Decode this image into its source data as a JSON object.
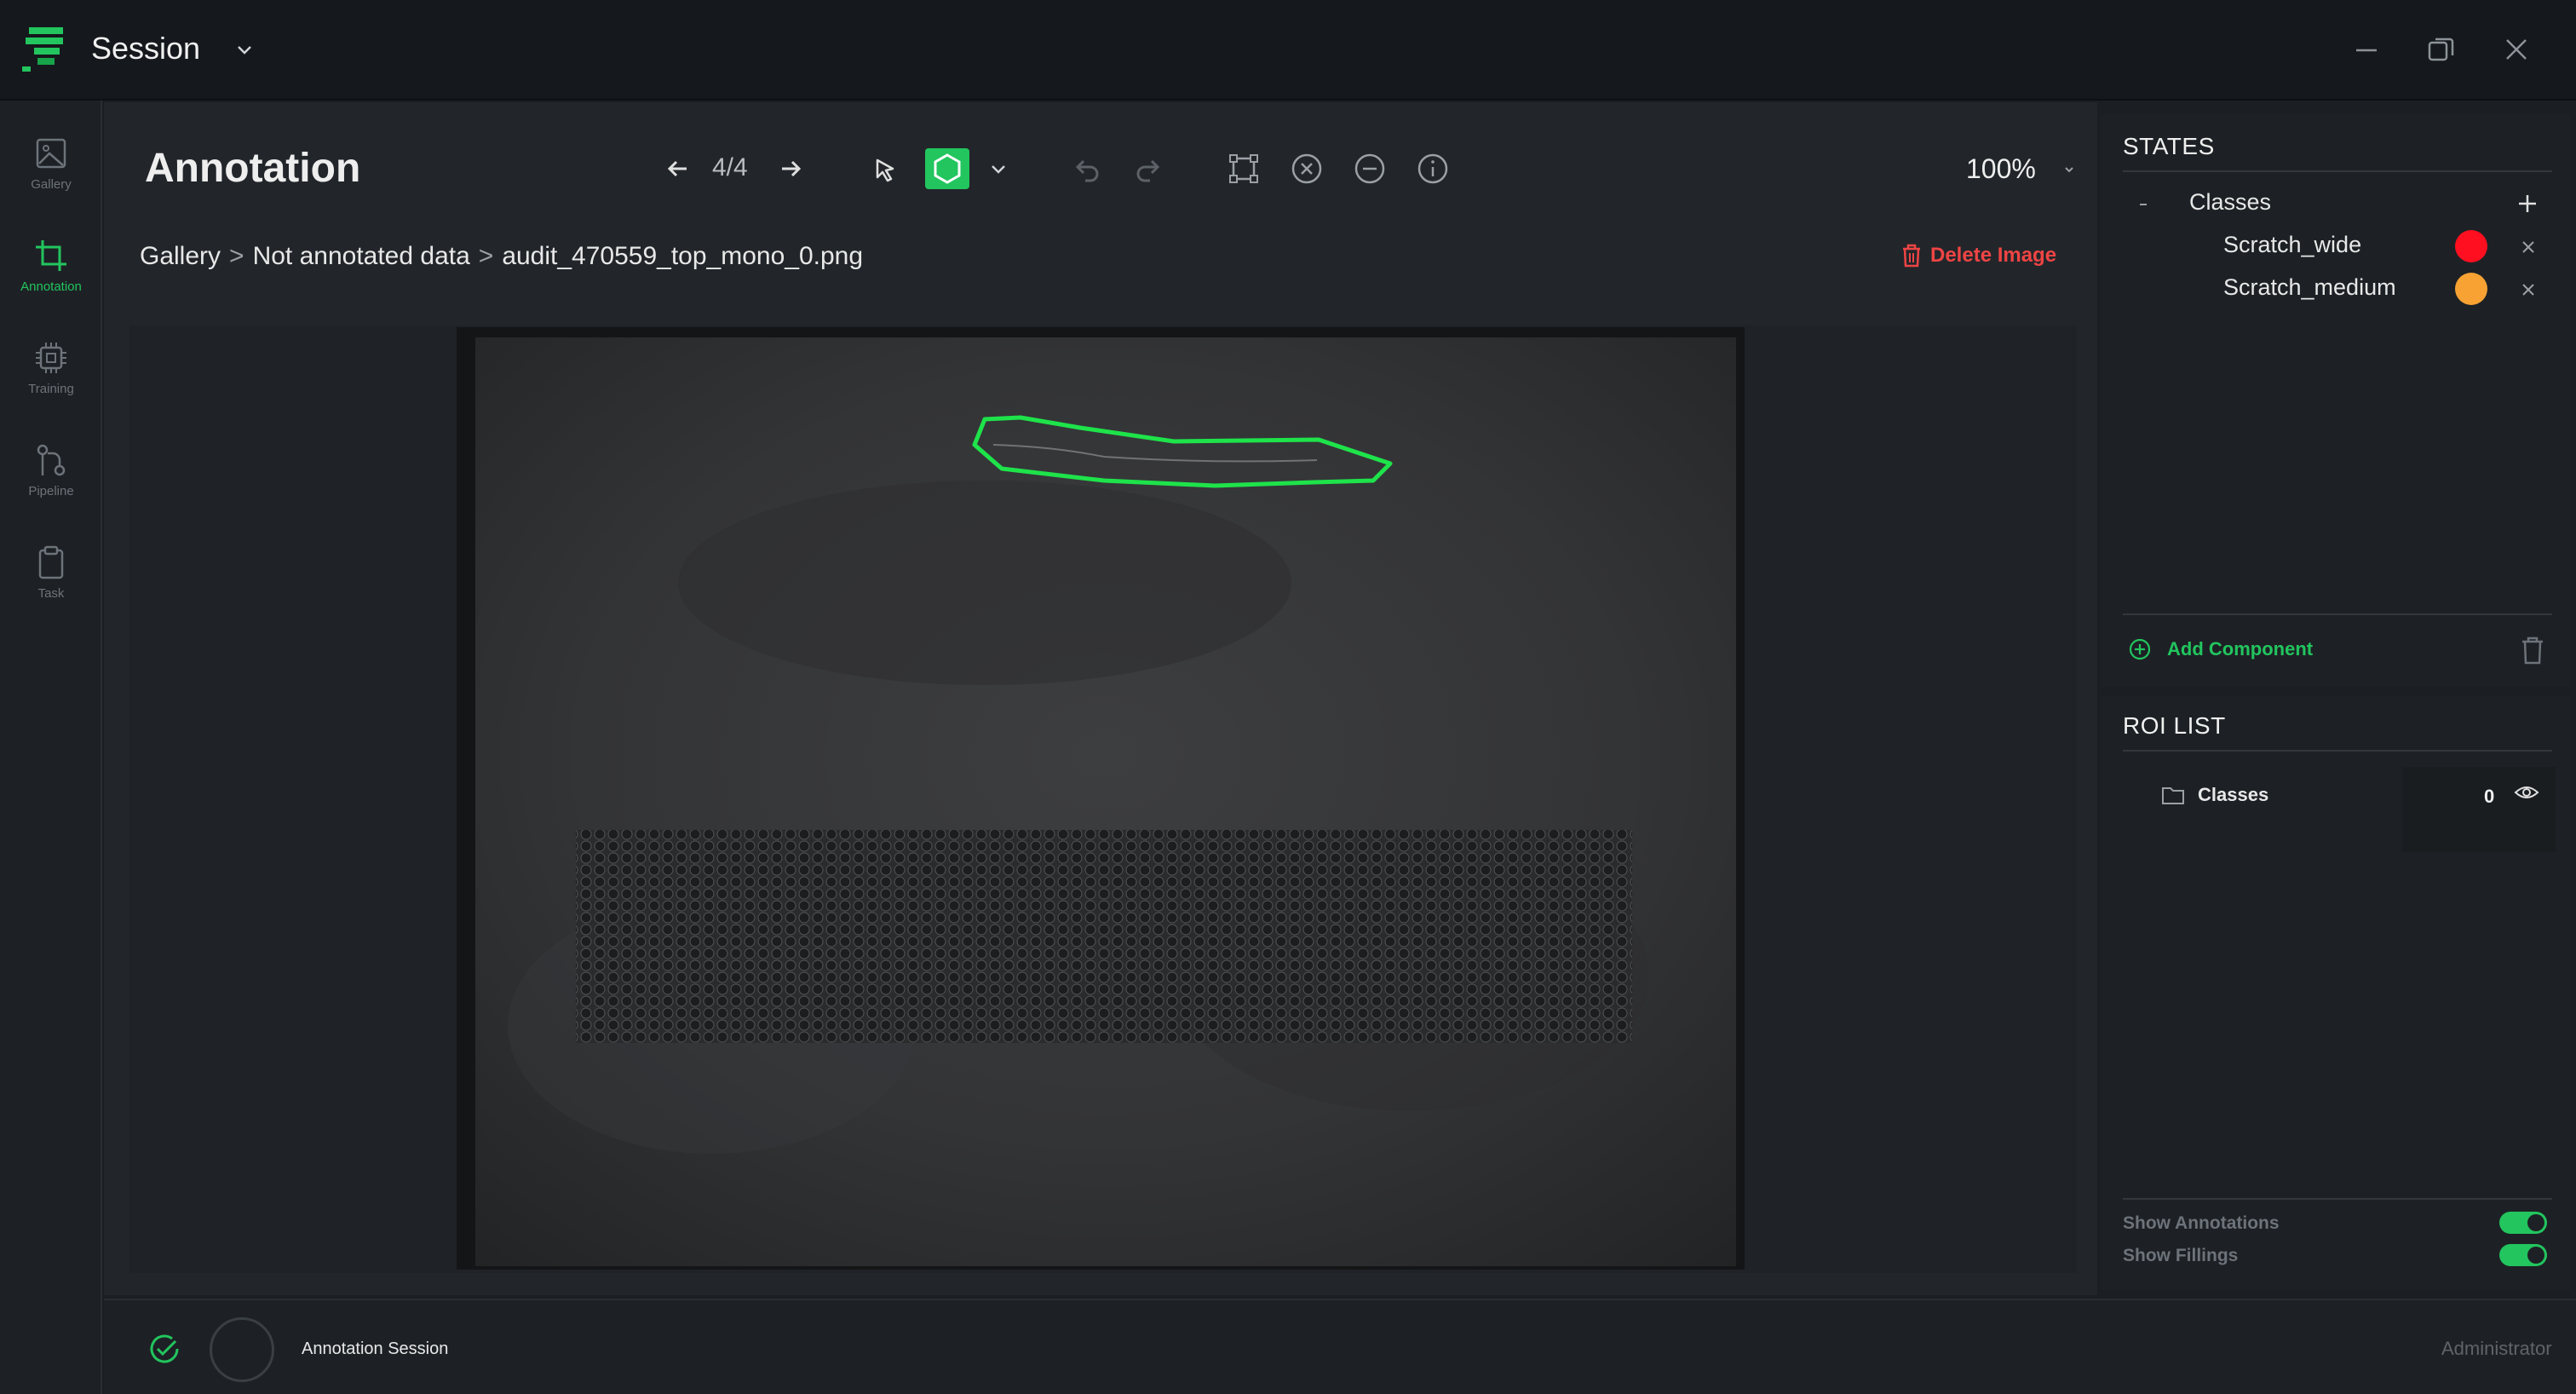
{
  "titlebar": {
    "app_title": "Session",
    "icons": [
      "app-logo",
      "chevron-down-icon",
      "minimize-icon",
      "restore-icon",
      "close-icon"
    ]
  },
  "nav": {
    "items": [
      {
        "label": "Gallery",
        "icon": "image-icon",
        "active": false
      },
      {
        "label": "Annotation",
        "icon": "crop-icon",
        "active": true
      },
      {
        "label": "Training",
        "icon": "chip-icon",
        "active": false
      },
      {
        "label": "Pipeline",
        "icon": "git-branch-icon",
        "active": false
      },
      {
        "label": "Task",
        "icon": "clipboard-icon",
        "active": false
      }
    ]
  },
  "header": {
    "title": "Annotation",
    "counter": "4/4",
    "zoom": "100%"
  },
  "breadcrumb": {
    "items": [
      "Gallery",
      "Not annotated data",
      "audit_470559_top_mono_0.png"
    ],
    "separator": ">"
  },
  "actions": {
    "delete_image": "Delete Image"
  },
  "states": {
    "heading": "STATES",
    "group_label": "Classes",
    "classes": [
      {
        "name": "Scratch_wide",
        "color": "#ff0f1f"
      },
      {
        "name": "Scratch_medium",
        "color": "#f7a233"
      }
    ],
    "add_component": "Add Component"
  },
  "roi": {
    "heading": "ROI LIST",
    "folder_label": "Classes",
    "count": "0"
  },
  "toggles": {
    "show_annotations": {
      "label": "Show Annotations",
      "on": true
    },
    "show_fillings": {
      "label": "Show Fillings",
      "on": true
    }
  },
  "bottom": {
    "session_label": "Annotation Session",
    "user": "Administrator"
  },
  "colors": {
    "accent": "#22c55e",
    "danger": "#ef4444",
    "annotation_stroke": "#1ee34a"
  }
}
